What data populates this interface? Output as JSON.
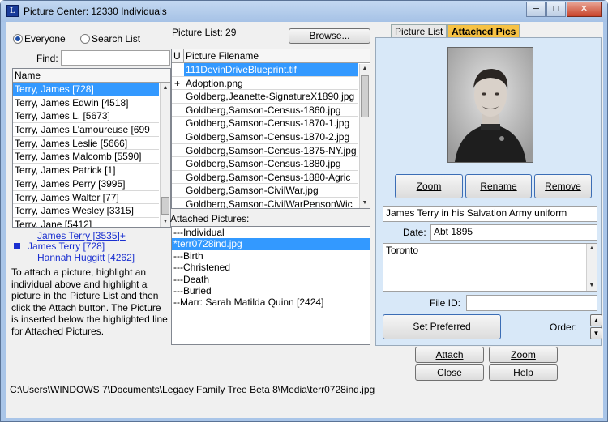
{
  "window": {
    "title": "Picture Center: 12330 Individuals"
  },
  "search": {
    "radio_everyone": "Everyone",
    "radio_search_list": "Search List",
    "find_label": "Find:",
    "find_value": ""
  },
  "names": {
    "header": "Name",
    "items": [
      "Terry, James [728]",
      "Terry, James Edwin [4518]",
      "Terry, James L. [5673]",
      "Terry, James L'amoureuse [699",
      "Terry, James Leslie [5666]",
      "Terry, James Malcomb [5590]",
      "Terry, James Patrick [1]",
      "Terry, James Perry [3995]",
      "Terry, James Walter [77]",
      "Terry, James Wesley [3315]",
      "Terry, Jane [5412]"
    ]
  },
  "family": {
    "father": "James Terry [3535]+",
    "self": "James Terry [728]",
    "mother": "Hannah Huggitt [4262]"
  },
  "instructions": "To attach a picture, highlight an individual above and highlight a picture in the Picture List and then click the Attach button.  The Picture is inserted below the highlighted line for Attached Pictures.",
  "picture_list": {
    "label": "Picture List: 29",
    "browse": "Browse...",
    "col_u": "U",
    "col_filename": "Picture Filename",
    "items": [
      {
        "u": "",
        "name": "111DevinDriveBlueprint.tif"
      },
      {
        "u": "+",
        "name": "Adoption.png"
      },
      {
        "u": "",
        "name": "Goldberg,Jeanette-SignatureX1890.jpg"
      },
      {
        "u": "",
        "name": "Goldberg,Samson-Census-1860.jpg"
      },
      {
        "u": "",
        "name": "Goldberg,Samson-Census-1870-1.jpg"
      },
      {
        "u": "",
        "name": "Goldberg,Samson-Census-1870-2.jpg"
      },
      {
        "u": "",
        "name": "Goldberg,Samson-Census-1875-NY.jpg"
      },
      {
        "u": "",
        "name": "Goldberg,Samson-Census-1880.jpg"
      },
      {
        "u": "",
        "name": "Goldberg,Samson-Census-1880-Agric"
      },
      {
        "u": "",
        "name": "Goldberg,Samson-CivilWar.jpg"
      },
      {
        "u": "",
        "name": "Goldberg,Samson-CivilWarPensonWic"
      }
    ]
  },
  "attached": {
    "label": "Attached Pictures:",
    "items": [
      "---Individual",
      "*terr0728ind.jpg",
      "---Birth",
      "---Christened",
      "---Death",
      "---Buried",
      "--Marr: Sarah Matilda Quinn [2424]"
    ]
  },
  "tabs": {
    "picture_list": "Picture List",
    "attached_pics": "Attached Pics"
  },
  "detail": {
    "zoom": "Zoom",
    "rename": "Rename",
    "remove": "Remove",
    "caption": "James Terry in his Salvation Army uniform",
    "date_label": "Date:",
    "date_value": "Abt 1895",
    "description": "Toronto",
    "file_id_label": "File ID:",
    "file_id_value": "",
    "set_preferred": "Set Preferred",
    "order_label": "Order:"
  },
  "actions": {
    "attach": "Attach",
    "zoom": "Zoom",
    "close": "Close",
    "help": "Help"
  },
  "status_path": "C:\\Users\\WINDOWS 7\\Documents\\Legacy Family Tree Beta 8\\Media\\terr0728ind.jpg"
}
